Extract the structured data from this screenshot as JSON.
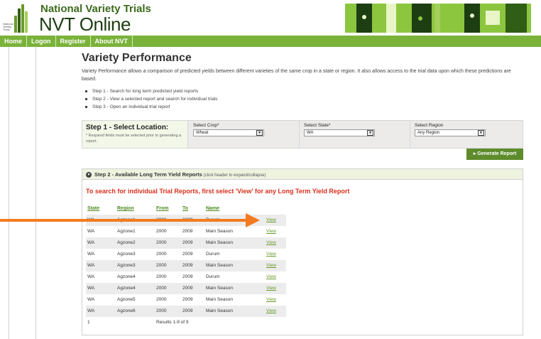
{
  "brand": {
    "line1": "National Variety Trials",
    "line2": "NVT Online",
    "logo_small_text": "National Variety Trials"
  },
  "nav": {
    "items": [
      "Home",
      "Logon",
      "Register",
      "About NVT"
    ]
  },
  "page": {
    "title": "Variety Performance",
    "description": "Variety Performance allows a comparison of predicted yields between different varieties of the same crop in a state or region. It also allows access to the trial data upon which these predictions are based.",
    "steps": [
      "Step 1 - Search for long term predicted yield reports",
      "Step 2 - View a selected report and search for individual trials",
      "Step 3 - Open an individual trial report"
    ]
  },
  "location": {
    "title": "Step 1 - Select Location:",
    "note": "* Required fields must be selected prior to generating a report.",
    "crop_label": "Select Crop*",
    "crop_value": "Wheat",
    "state_label": "Select State*",
    "state_value": "WA",
    "region_label": "Select Region",
    "region_value": "Any Region",
    "generate_label": "▸ Generate Report"
  },
  "step2": {
    "header": "Step 2 - Available Long Term Yield Reports",
    "hint": "(click header to expand/collapse)",
    "instruction": "To search for individual Trial Reports, first select 'View' for any Long Term Yield Report",
    "columns": [
      "State",
      "Region",
      "From",
      "To",
      "Name"
    ],
    "rows": [
      {
        "state": "WA",
        "region": "Agzone1",
        "from": "2000",
        "to": "2009",
        "name": "Durum",
        "view": "View"
      },
      {
        "state": "WA",
        "region": "Agzone1",
        "from": "2000",
        "to": "2009",
        "name": "Main Season",
        "view": "View"
      },
      {
        "state": "WA",
        "region": "Agzone2",
        "from": "2000",
        "to": "2009",
        "name": "Main Season",
        "view": "View"
      },
      {
        "state": "WA",
        "region": "Agzone3",
        "from": "2000",
        "to": "2009",
        "name": "Durum",
        "view": "View"
      },
      {
        "state": "WA",
        "region": "Agzone3",
        "from": "2000",
        "to": "2009",
        "name": "Main Season",
        "view": "View"
      },
      {
        "state": "WA",
        "region": "Agzone4",
        "from": "2000",
        "to": "2009",
        "name": "Durum",
        "view": "View"
      },
      {
        "state": "WA",
        "region": "Agzone4",
        "from": "2000",
        "to": "2009",
        "name": "Main Season",
        "view": "View"
      },
      {
        "state": "WA",
        "region": "Agzone5",
        "from": "2000",
        "to": "2009",
        "name": "Main Season",
        "view": "View"
      },
      {
        "state": "WA",
        "region": "Agzone6",
        "from": "2000",
        "to": "2009",
        "name": "Main Season",
        "view": "View"
      }
    ],
    "page_number": "1",
    "results_text": "Results 1-9 of 9"
  },
  "colors": {
    "accent_green": "#7ab23a",
    "dark_green": "#5e8c2c",
    "instruction_red": "#d9301d",
    "arrow_orange": "#f47b20"
  }
}
